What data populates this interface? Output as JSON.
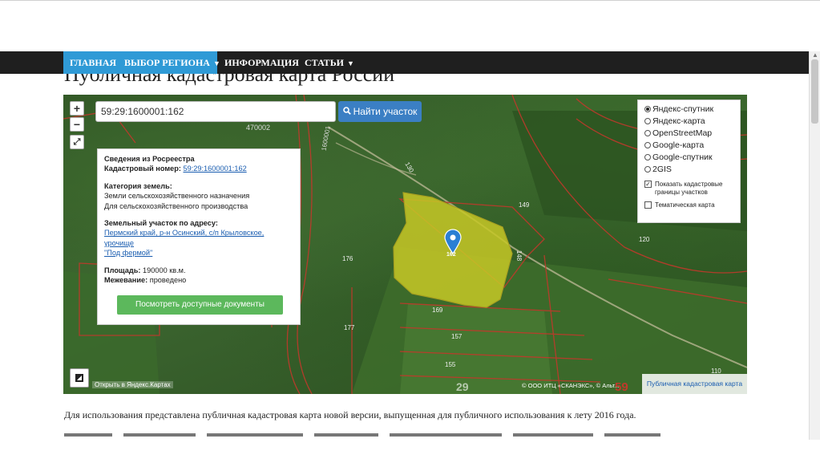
{
  "nav": {
    "items": [
      {
        "label": "ГЛАВНАЯ",
        "active": true,
        "caret": false
      },
      {
        "label": "ВЫБОР РЕГИОНА",
        "active": true,
        "caret": true
      },
      {
        "label": "ИНФОРМАЦИЯ",
        "active": false,
        "caret": false
      },
      {
        "label": "СТАТЬИ",
        "active": false,
        "caret": true
      }
    ]
  },
  "page": {
    "heading": "Публичная кадастровая карта России",
    "paragraph": "Для использования представлена публичная кадастровая карта новой версии, выпущенная для публичного использования к лету 2016 года."
  },
  "map": {
    "zoom_in": "+",
    "zoom_out": "−",
    "fullscreen": "⤢",
    "search_value": "59:29:1600001:162",
    "search_button": "Найти участок",
    "info": {
      "title": "Сведения из Росреестра",
      "cadastral_label": "Кадастровый номер:",
      "cadastral_value": "59:29:1600001:162",
      "category_label": "Категория земель:",
      "category_value": "Земли сельскохозяйственного назначения",
      "usage_value": "Для сельскохозяйственного производства",
      "address_label": "Земельный участок по адресу:",
      "address_line1": "Пермский край, р-н Осинский, с/п Крыловское, урочище",
      "address_line2": "\"Под фермой\"",
      "area_label": "Площадь:",
      "area_value": "190000 кв.м.",
      "survey_label": "Межевание:",
      "survey_value": "проведено",
      "docs_button": "Посмотреть доступные документы"
    },
    "layers": {
      "options": [
        {
          "label": "Яндекс-спутник",
          "selected": true
        },
        {
          "label": "Яндекс-карта",
          "selected": false
        },
        {
          "label": "OpenStreetMap",
          "selected": false
        },
        {
          "label": "Google-карта",
          "selected": false
        },
        {
          "label": "Google-спутник",
          "selected": false
        },
        {
          "label": "2GIS",
          "selected": false
        }
      ],
      "show_boundaries": "Показать кадастровые границы участков",
      "show_boundaries_checked": "✓",
      "thematic": "Тематическая карта"
    },
    "parcel_labels": [
      "149",
      "120",
      "176",
      "169",
      "177",
      "157",
      "155",
      "162",
      "148",
      "130",
      "110"
    ],
    "map_labels": [
      "470002",
      "1600001",
      "29",
      "59"
    ],
    "attribution_left": "Открыть в Яндекс.Картах",
    "attribution_right": "© ООО ИТЦ «СКАНЭКС», © Альт...",
    "pkk_link": "Публичная кадастровая карта"
  }
}
